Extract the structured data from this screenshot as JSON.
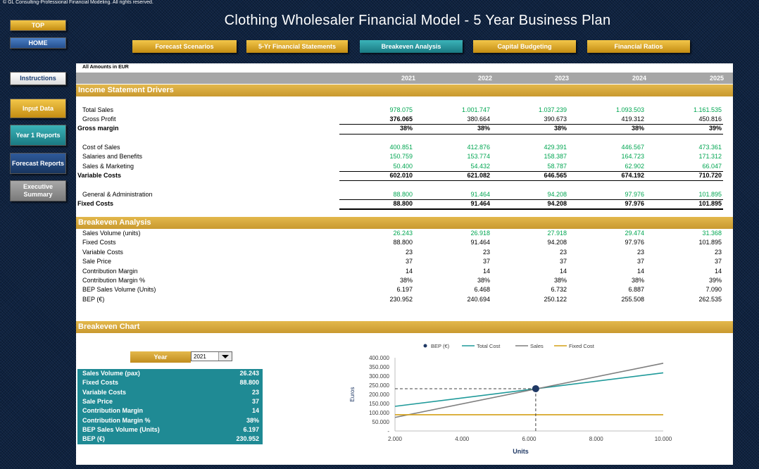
{
  "copyright": "© GL Consulting-Professional Financial Modeling. All rights reserved.",
  "title": "Clothing Wholesaler Financial Model - 5 Year Business Plan",
  "sidebar": {
    "top": "TOP",
    "home": "HOME",
    "instructions": "Instructions",
    "input_data": "Input Data",
    "year1_reports": "Year 1 Reports",
    "forecast_reports": "Forecast Reports",
    "executive_summary": "Executive Summary"
  },
  "nav": {
    "forecast_scenarios": "Forecast Scenarios",
    "financial_statements": "5-Yr Financial Statements",
    "breakeven_analysis": "Breakeven Analysis",
    "capital_budgeting": "Capital Budgeting",
    "financial_ratios": "Financial Ratios"
  },
  "amounts_label": "All Amounts in  EUR",
  "years": [
    "2021",
    "2022",
    "2023",
    "2024",
    "2025"
  ],
  "income": {
    "title": "Income Statement Drivers",
    "total_sales": {
      "label": "Total Sales",
      "values": [
        "978.075",
        "1.001.747",
        "1.037.239",
        "1.093.503",
        "1.161.535"
      ]
    },
    "gross_profit": {
      "label": "Gross Profit",
      "values": [
        "376.065",
        "380.664",
        "390.673",
        "419.312",
        "450.816"
      ]
    },
    "gross_margin": {
      "label": "Gross margin",
      "values": [
        "38%",
        "38%",
        "38%",
        "38%",
        "39%"
      ]
    },
    "cost_of_sales": {
      "label": "Cost of Sales",
      "values": [
        "400.851",
        "412.876",
        "429.391",
        "446.567",
        "473.361"
      ]
    },
    "salaries": {
      "label": "Salaries and Benefits",
      "values": [
        "150.759",
        "153.774",
        "158.387",
        "164.723",
        "171.312"
      ]
    },
    "sales_marketing": {
      "label": "Sales & Marketing",
      "values": [
        "50.400",
        "54.432",
        "58.787",
        "62.902",
        "66.047"
      ]
    },
    "variable_costs": {
      "label": "Variable Costs",
      "values": [
        "602.010",
        "621.082",
        "646.565",
        "674.192",
        "710.720"
      ]
    },
    "gen_admin": {
      "label": "General & Administration",
      "values": [
        "88.800",
        "91.464",
        "94.208",
        "97.976",
        "101.895"
      ]
    },
    "fixed_costs": {
      "label": "Fixed Costs",
      "values": [
        "88.800",
        "91.464",
        "94.208",
        "97.976",
        "101.895"
      ]
    }
  },
  "breakeven": {
    "title": "Breakeven Analysis",
    "rows": [
      {
        "label": "Sales Volume (units)",
        "values": [
          "26.243",
          "26.918",
          "27.918",
          "29.474",
          "31.368"
        ],
        "green": true
      },
      {
        "label": "Fixed Costs",
        "values": [
          "88.800",
          "91.464",
          "94.208",
          "97.976",
          "101.895"
        ]
      },
      {
        "label": "Variable Costs",
        "values": [
          "23",
          "23",
          "23",
          "23",
          "23"
        ]
      },
      {
        "label": "Sale Price",
        "values": [
          "37",
          "37",
          "37",
          "37",
          "37"
        ]
      },
      {
        "label": "Contribution Margin",
        "values": [
          "14",
          "14",
          "14",
          "14",
          "14"
        ]
      },
      {
        "label": "Contribution Margin %",
        "values": [
          "38%",
          "38%",
          "38%",
          "38%",
          "39%"
        ]
      },
      {
        "label": "BEP Sales Volume (Units)",
        "values": [
          "6.197",
          "6.468",
          "6.732",
          "6.887",
          "7.090"
        ]
      },
      {
        "label": "BEP (€)",
        "values": [
          "230.952",
          "240.694",
          "250.122",
          "255.508",
          "262.535"
        ]
      }
    ]
  },
  "chart_section": {
    "title": "Breakeven Chart",
    "year_label": "Year",
    "year_value": "2021",
    "summary": [
      {
        "label": "Sales Volume (pax)",
        "value": "26.243"
      },
      {
        "label": "Fixed Costs",
        "value": "88.800"
      },
      {
        "label": "Variable Costs",
        "value": "23"
      },
      {
        "label": "Sale Price",
        "value": "37"
      },
      {
        "label": "Contribution Margin",
        "value": "14"
      },
      {
        "label": "Contribution Margin %",
        "value": "38%"
      },
      {
        "label": "BEP Sales Volume (Units)",
        "value": "6.197"
      },
      {
        "label": "BEP (€)",
        "value": "230.952"
      }
    ]
  },
  "colors": {
    "sales": "#7f7f7f",
    "total_cost": "#1f9a9a",
    "fixed_cost": "#d4a017",
    "bep": "#1f3864"
  },
  "chart_data": {
    "type": "line",
    "xlabel": "Units",
    "ylabel": "Euros",
    "xlim": [
      2000,
      10000
    ],
    "ylim": [
      0,
      400000
    ],
    "x_ticks": [
      "2.000",
      "4.000",
      "6.000",
      "8.000",
      "10.000"
    ],
    "y_ticks": [
      "-",
      "50.000",
      "100.000",
      "150.000",
      "200.000",
      "250.000",
      "300.000",
      "350.000",
      "400.000"
    ],
    "legend": [
      "BEP (€)",
      "Total Cost",
      "Sales",
      "Fixed Cost"
    ],
    "legend_position": "top",
    "x": [
      2000,
      10000
    ],
    "series": [
      {
        "name": "Total Cost",
        "values": [
          134600,
          317400
        ]
      },
      {
        "name": "Sales",
        "values": [
          74000,
          370000
        ]
      },
      {
        "name": "Fixed Cost",
        "values": [
          88800,
          88800
        ]
      }
    ],
    "bep": {
      "name": "BEP (€)",
      "x": 6197,
      "y": 230952
    }
  }
}
